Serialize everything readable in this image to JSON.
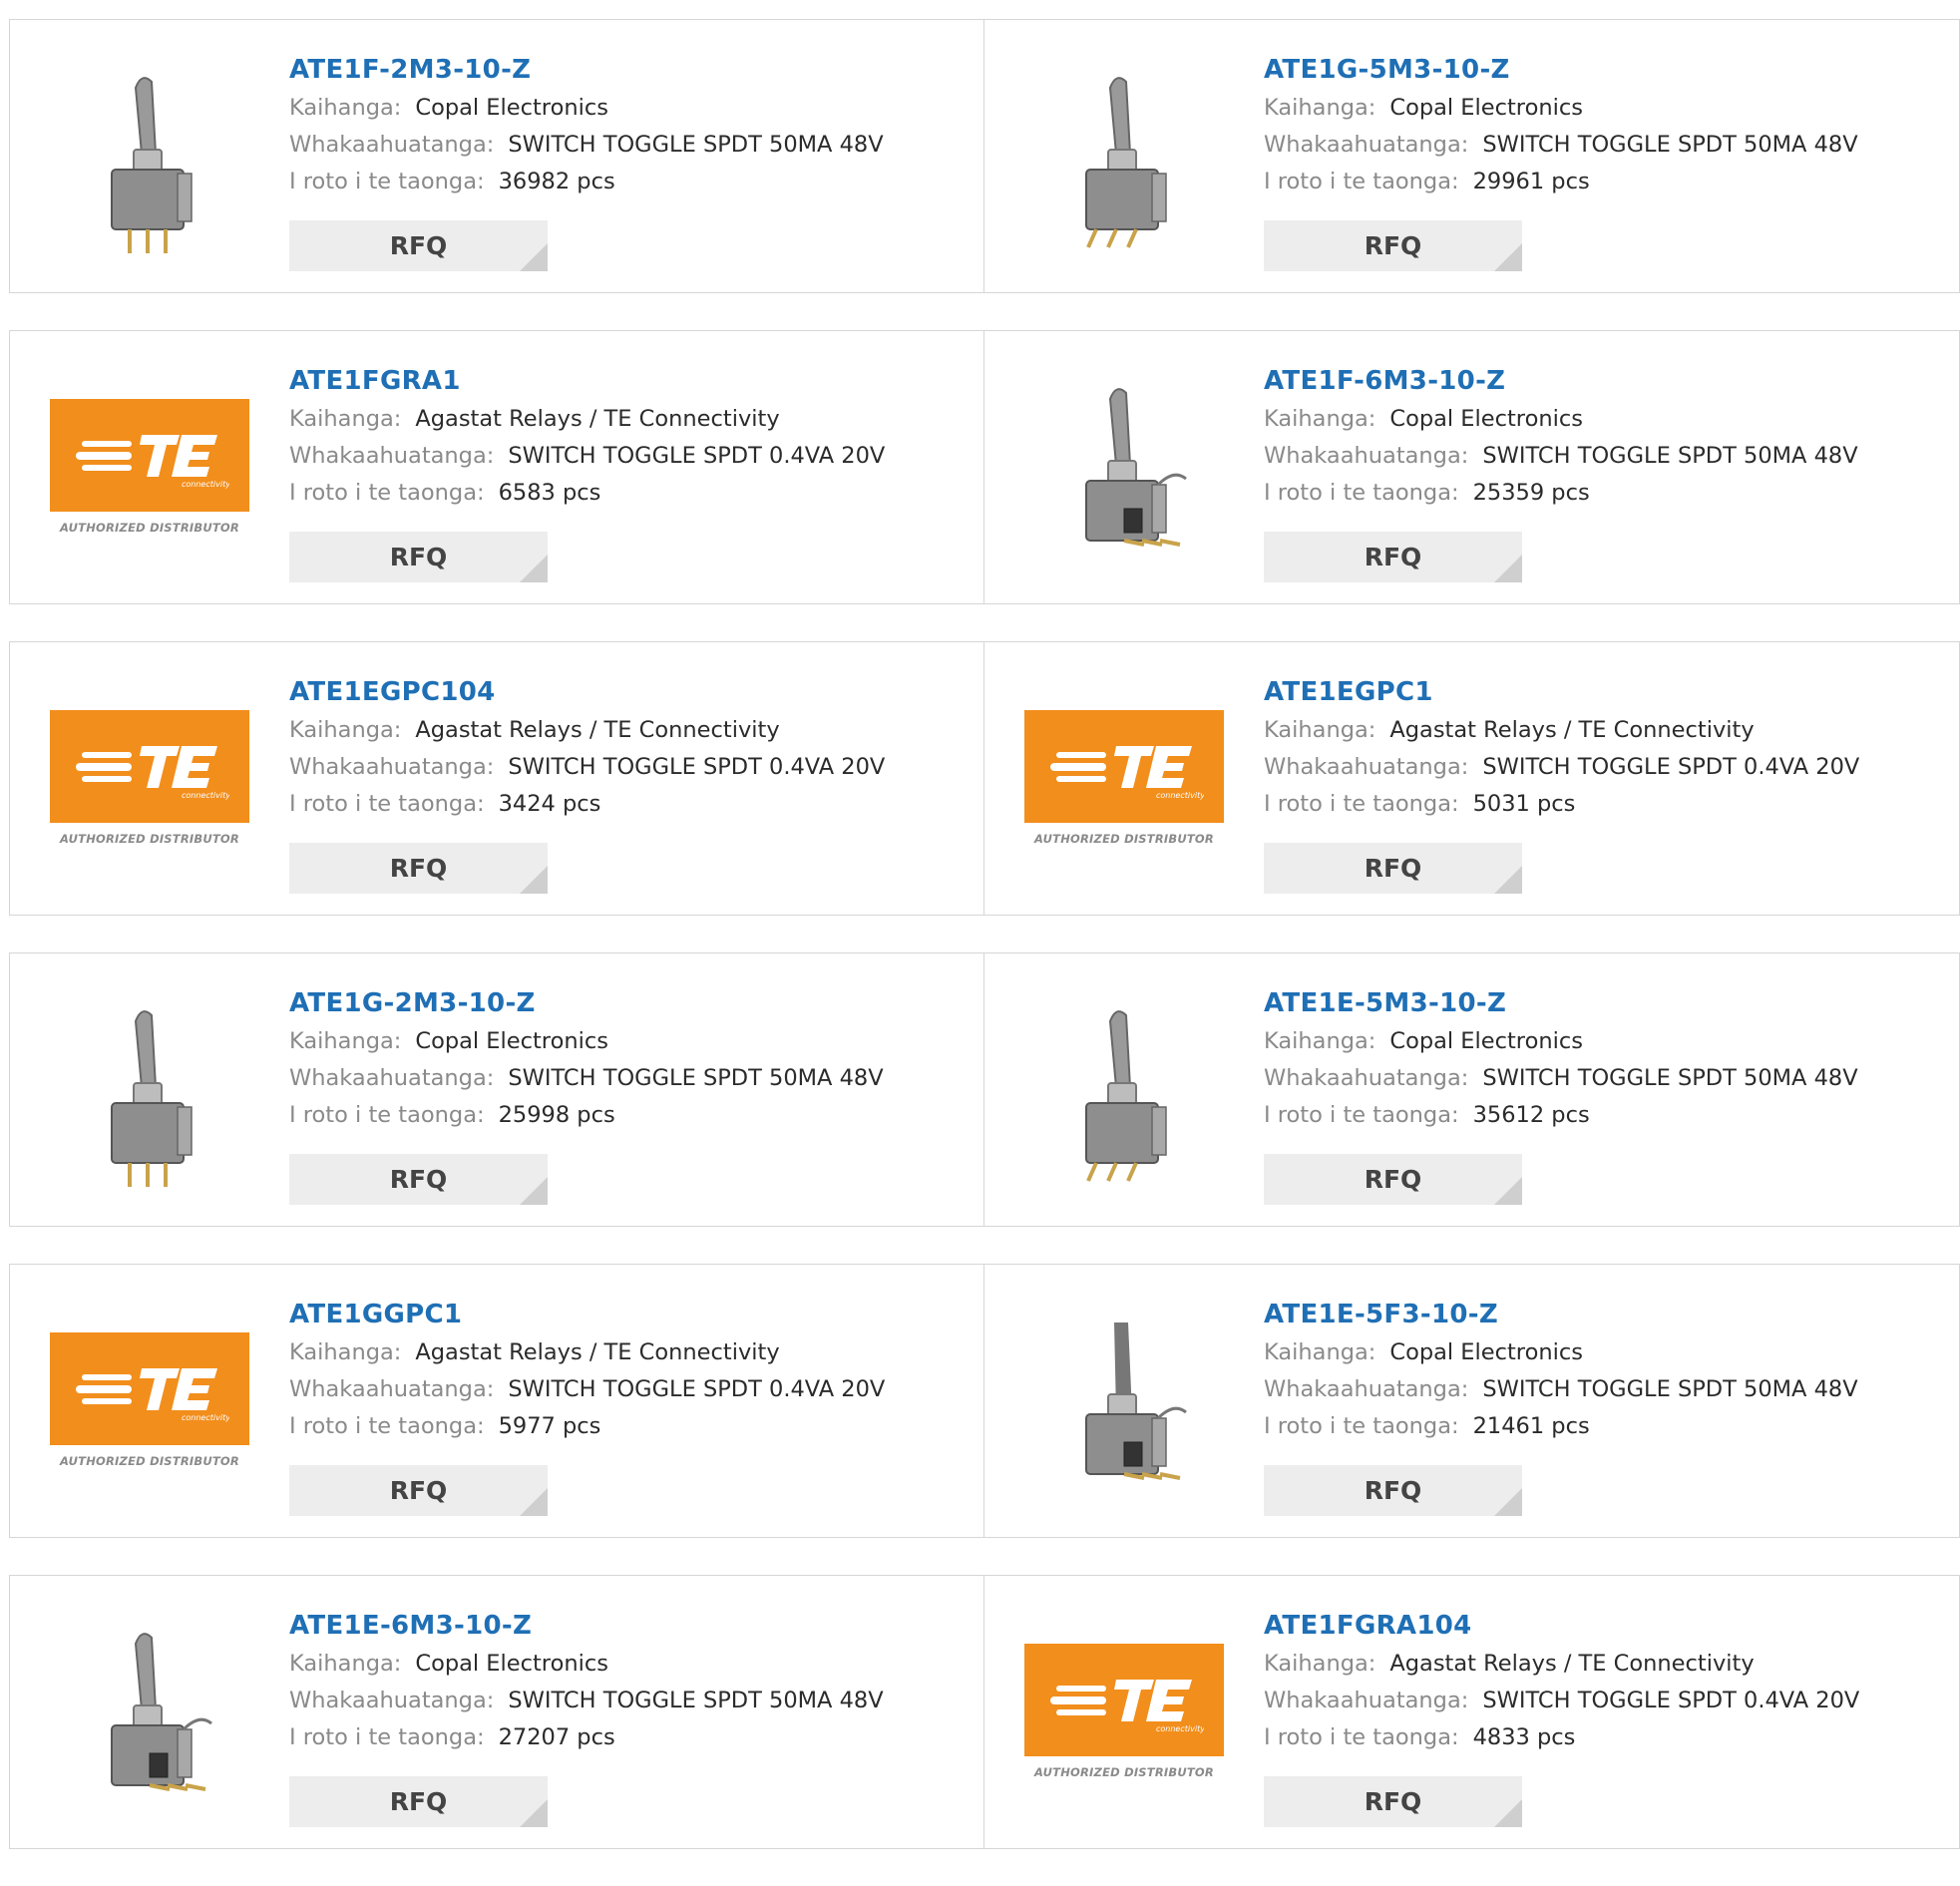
{
  "labels": {
    "manufacturer": "Kaihanga:",
    "description": "Whakaahuatanga:",
    "stock": "I roto i te taonga:",
    "rfq": "RFQ",
    "te_tagline": "connectivity",
    "te_authorized": "AUTHORIZED DISTRIBUTOR"
  },
  "colors": {
    "part_link": "#1f6fb5",
    "te_orange": "#f28e1c",
    "rfq_bg": "#ededed"
  },
  "products": [
    {
      "part": "ATE1F-2M3-10-Z",
      "manufacturer": "Copal Electronics",
      "description": "SWITCH TOGGLE SPDT 50MA 48V",
      "stock": "36982 pcs",
      "image": "toggle-switch-straight"
    },
    {
      "part": "ATE1G-5M3-10-Z",
      "manufacturer": "Copal Electronics",
      "description": "SWITCH TOGGLE SPDT 50MA 48V",
      "stock": "29961 pcs",
      "image": "toggle-switch-angled"
    },
    {
      "part": "ATE1FGRA1",
      "manufacturer": "Agastat Relays / TE Connectivity",
      "description": "SWITCH TOGGLE SPDT 0.4VA 20V",
      "stock": "6583 pcs",
      "image": "te-logo"
    },
    {
      "part": "ATE1F-6M3-10-Z",
      "manufacturer": "Copal Electronics",
      "description": "SWITCH TOGGLE SPDT 50MA 48V",
      "stock": "25359 pcs",
      "image": "toggle-switch-side"
    },
    {
      "part": "ATE1EGPC104",
      "manufacturer": "Agastat Relays / TE Connectivity",
      "description": "SWITCH TOGGLE SPDT 0.4VA 20V",
      "stock": "3424 pcs",
      "image": "te-logo"
    },
    {
      "part": "ATE1EGPC1",
      "manufacturer": "Agastat Relays / TE Connectivity",
      "description": "SWITCH TOGGLE SPDT 0.4VA 20V",
      "stock": "5031 pcs",
      "image": "te-logo"
    },
    {
      "part": "ATE1G-2M3-10-Z",
      "manufacturer": "Copal Electronics",
      "description": "SWITCH TOGGLE SPDT 50MA 48V",
      "stock": "25998 pcs",
      "image": "toggle-switch-straight"
    },
    {
      "part": "ATE1E-5M3-10-Z",
      "manufacturer": "Copal Electronics",
      "description": "SWITCH TOGGLE SPDT 50MA 48V",
      "stock": "35612 pcs",
      "image": "toggle-switch-angled"
    },
    {
      "part": "ATE1GGPC1",
      "manufacturer": "Agastat Relays / TE Connectivity",
      "description": "SWITCH TOGGLE SPDT 0.4VA 20V",
      "stock": "5977 pcs",
      "image": "te-logo"
    },
    {
      "part": "ATE1E-5F3-10-Z",
      "manufacturer": "Copal Electronics",
      "description": "SWITCH TOGGLE SPDT 50MA 48V",
      "stock": "21461 pcs",
      "image": "toggle-switch-flat"
    },
    {
      "part": "ATE1E-6M3-10-Z",
      "manufacturer": "Copal Electronics",
      "description": "SWITCH TOGGLE SPDT 50MA 48V",
      "stock": "27207 pcs",
      "image": "toggle-switch-side"
    },
    {
      "part": "ATE1FGRA104",
      "manufacturer": "Agastat Relays / TE Connectivity",
      "description": "SWITCH TOGGLE SPDT 0.4VA 20V",
      "stock": "4833 pcs",
      "image": "te-logo"
    }
  ]
}
